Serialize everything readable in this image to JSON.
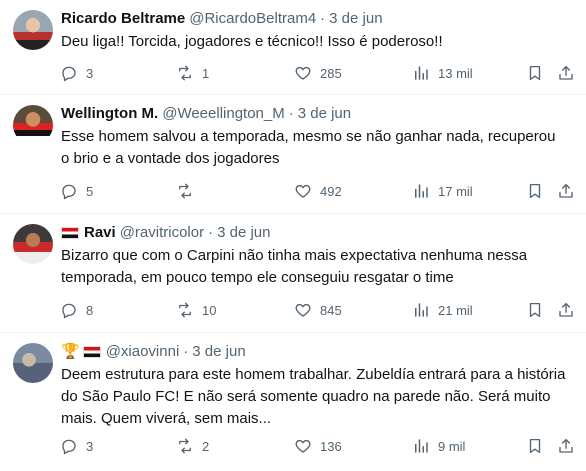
{
  "tweets": [
    {
      "name": "Ricardo Beltrame",
      "handle": "@RicardoBeltram4",
      "date": "3 de jun",
      "text": "Deu liga!! Torcida, jogadores e técnico!! Isso é poderoso!!",
      "replies": "3",
      "retweets": "1",
      "likes": "285",
      "views": "13 mil"
    },
    {
      "name": "Wellington M.",
      "handle": "@Weeellington_M",
      "date": "3 de jun",
      "text": "Esse homem salvou a temporada, mesmo se não ganhar nada, recuperou o brio e a vontade dos jogadores",
      "replies": "5",
      "retweets": "",
      "likes": "492",
      "views": "17 mil"
    },
    {
      "name": "Ravi",
      "handle": "@ravitricolor",
      "date": "3 de jun",
      "text": "Bizarro que com o Carpini não tinha mais expectativa nenhuma nessa temporada, em pouco tempo ele conseguiu resgatar o time",
      "replies": "8",
      "retweets": "10",
      "likes": "845",
      "views": "21 mil"
    },
    {
      "name": "",
      "handle": "@xiaovinni",
      "date": "3 de jun",
      "text": "Deem estrutura para este homem trabalhar. Zubeldía entrará para a história do São Paulo FC! E não será somente quadro na parede não. Será muito mais. Quem viverá, sem mais...",
      "replies": "3",
      "retweets": "2",
      "likes": "136",
      "views": "9 mil"
    }
  ],
  "separator": "·",
  "icons": {
    "reply": "reply-icon",
    "retweet": "retweet-icon",
    "like": "like-icon",
    "views": "views-icon",
    "bookmark": "bookmark-icon",
    "share": "share-icon"
  },
  "colors": {
    "text": "#0f1419",
    "muted": "#536471",
    "divider": "#eff3f4"
  }
}
